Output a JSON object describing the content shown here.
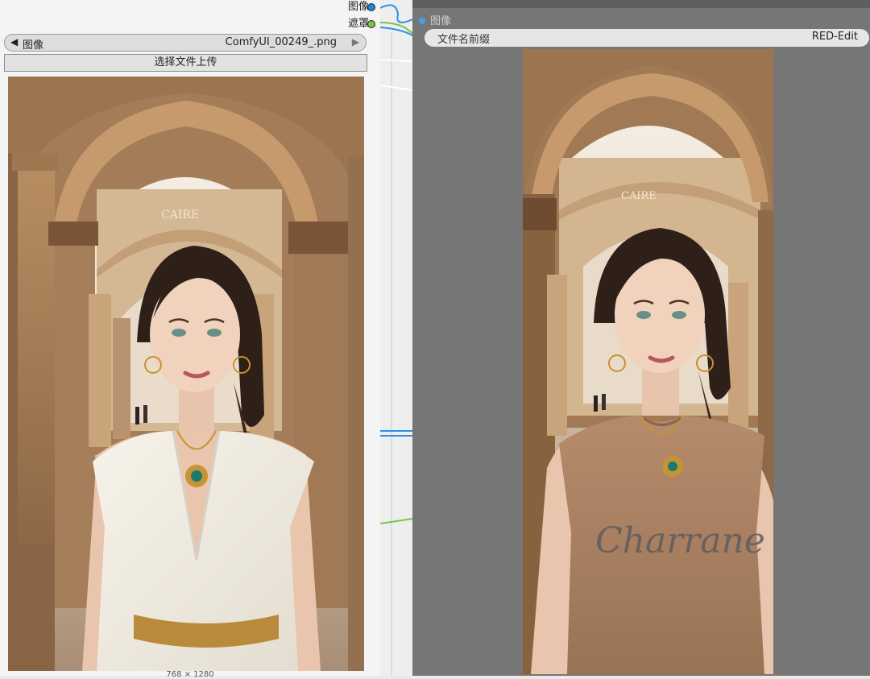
{
  "load_node": {
    "outputs": [
      {
        "label": "图像",
        "color": "#1f86e0"
      },
      {
        "label": "遮罩",
        "color": "#7cc24a"
      }
    ],
    "image_widget": {
      "name": "图像",
      "value": "ComfyUI_00249_.png"
    },
    "upload_label": "选择文件上传",
    "image_size": "768 × 1280"
  },
  "preview_node": {
    "input_label": "图像",
    "prefix_field": {
      "name": "文件名前缀",
      "value": "RED-Edit"
    },
    "source_sign": "CAIRE",
    "result_sign": "CAIRE",
    "shirt_text": "Charrane"
  },
  "colors": {
    "link_blue": "#2f8ee8",
    "link_green": "#7cc24a",
    "preview_bg": "#767676"
  }
}
